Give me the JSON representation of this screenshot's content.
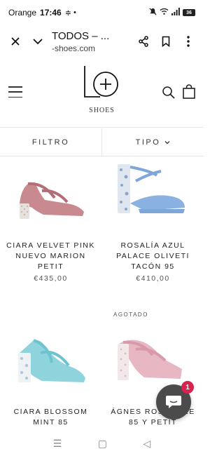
{
  "status": {
    "carrier": "Orange",
    "time": "17:46",
    "battery": "36"
  },
  "browser": {
    "title": "TODOS – ...",
    "url": "-shoes.com"
  },
  "site": {
    "logo_text": "SHOES"
  },
  "filters": {
    "filter_label": "FILTRO",
    "type_label": "TIPO"
  },
  "products": [
    {
      "name": "CIARA VELVET PINK NUEVO MARION PETIT",
      "price": "€435,00",
      "badge": ""
    },
    {
      "name": "ROSALÍA AZUL PALACE OLIVETI TACÓN 95",
      "price": "€410,00",
      "badge": ""
    },
    {
      "name": "CIARA BLOSSOM MINT 85",
      "price": "",
      "badge": ""
    },
    {
      "name": "ÁGNES ROSA … LE 85 Y PETIT",
      "price": "",
      "badge": "AGOTADO"
    }
  ],
  "chat": {
    "count": "1"
  },
  "nav": {
    "menu": "☰",
    "home": "▢",
    "back": "◁"
  },
  "colors": {
    "accent": "#d9234f",
    "chat": "#4b4b4b"
  }
}
